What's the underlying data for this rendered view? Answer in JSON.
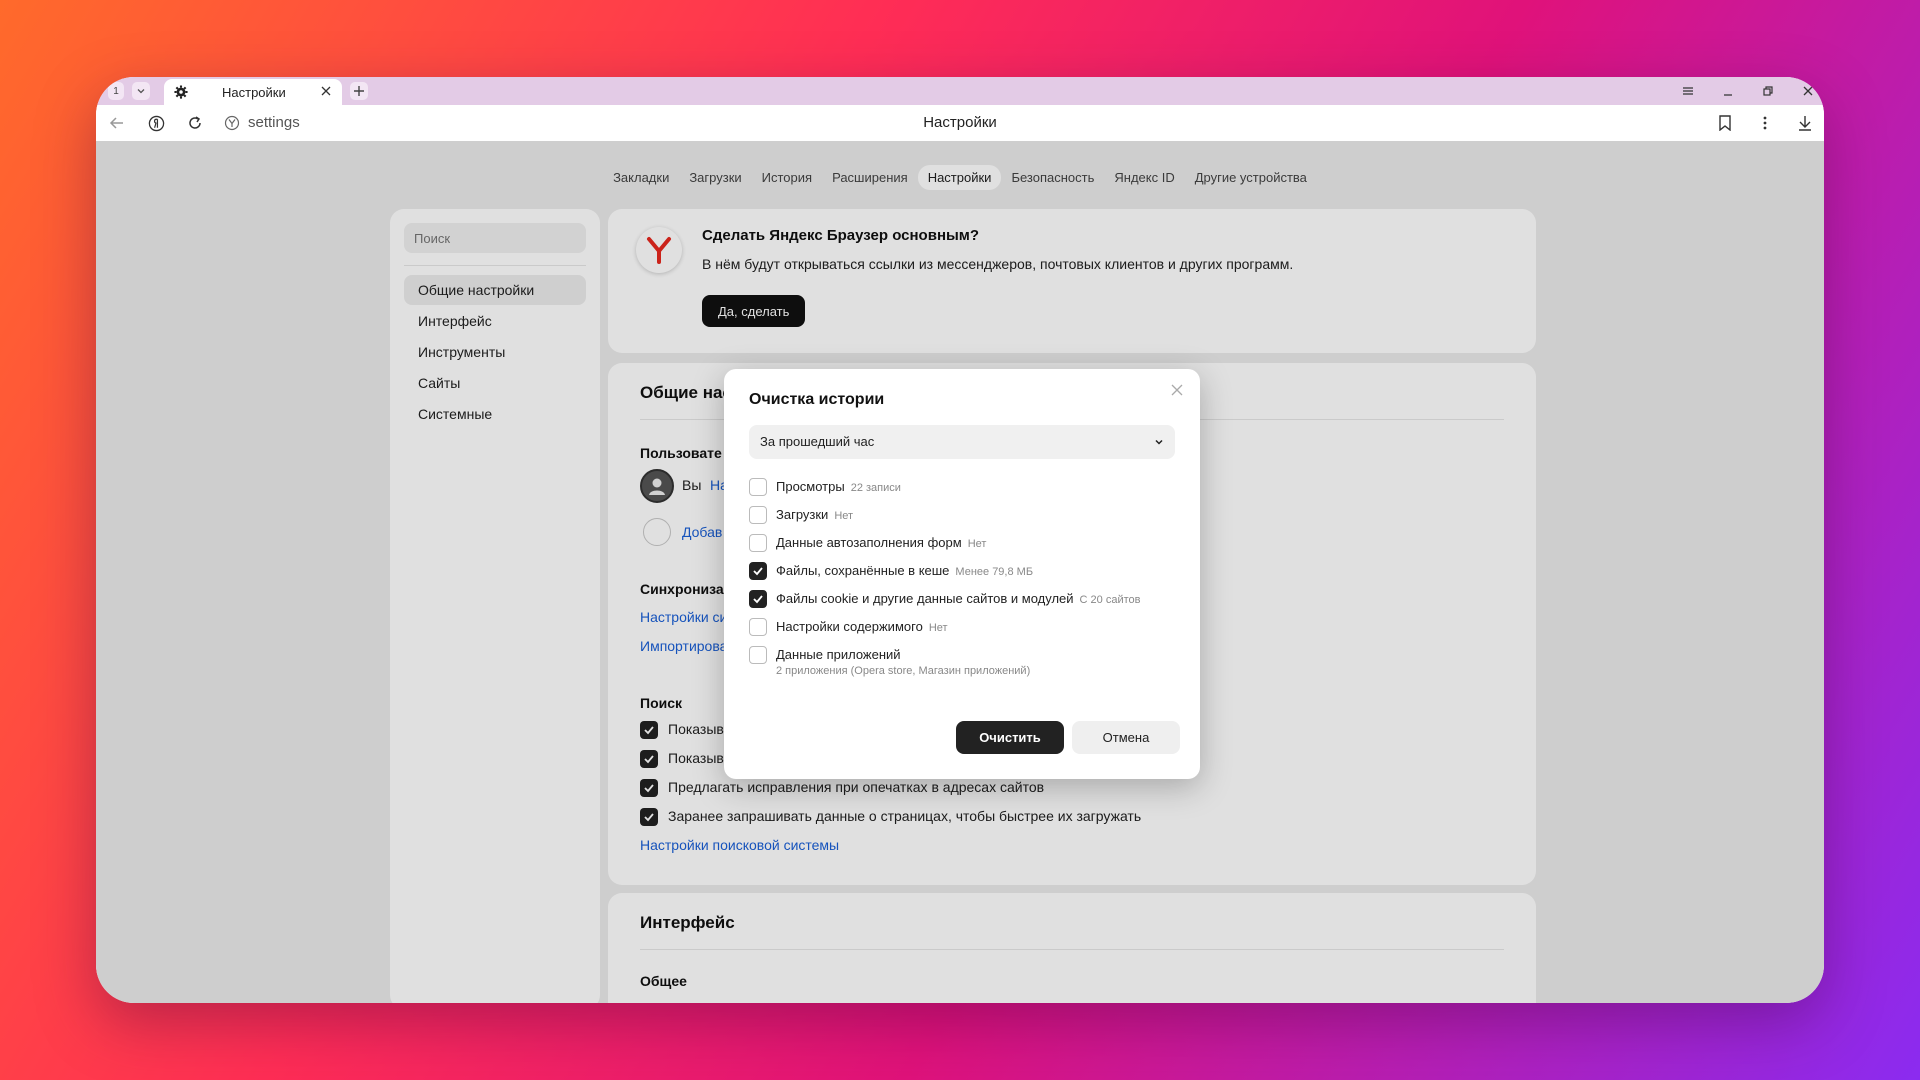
{
  "browser": {
    "tab_count": "1",
    "tab_title": "Настройки",
    "address": "settings",
    "page_title": "Настройки"
  },
  "nav_tabs": [
    {
      "label": "Закладки"
    },
    {
      "label": "Загрузки"
    },
    {
      "label": "История"
    },
    {
      "label": "Расширения"
    },
    {
      "label": "Настройки",
      "active": true
    },
    {
      "label": "Безопасность"
    },
    {
      "label": "Яндекс ID"
    },
    {
      "label": "Другие устройства"
    }
  ],
  "sidebar": {
    "search_placeholder": "Поиск",
    "items": [
      {
        "label": "Общие настройки"
      },
      {
        "label": "Интерфейс"
      },
      {
        "label": "Инструменты"
      },
      {
        "label": "Сайты"
      },
      {
        "label": "Системные"
      }
    ]
  },
  "promo": {
    "title": "Сделать Яндекс Браузер основным?",
    "text": "В нём будут открываться ссылки из мессенджеров, почтовых клиентов и других программ.",
    "button": "Да, сделать"
  },
  "general": {
    "title": "Общие нас",
    "users_title": "Пользовате",
    "you_label": "Вы",
    "you_link": "На",
    "add_link": "Добав",
    "sync_title": "Синхрониза",
    "sync_link1": "Настройки си",
    "sync_link2": "Импортирова",
    "search_title": "Поиск",
    "search_opts": [
      "Показыва",
      "Показыва",
      "Предлагать исправления при опечатках в адресах сайтов",
      "Заранее запрашивать данные о страницах, чтобы быстрее их загружать"
    ],
    "search_engine_link": "Настройки поисковой системы"
  },
  "interface": {
    "title": "Интерфейс",
    "sub": "Общее"
  },
  "dialog": {
    "title": "Очистка истории",
    "period": "За прошедший час",
    "options": [
      {
        "label": "Просмотры",
        "meta": "22 записи",
        "checked": false
      },
      {
        "label": "Загрузки",
        "meta": "Нет",
        "checked": false
      },
      {
        "label": "Данные автозаполнения форм",
        "meta": "Нет",
        "checked": false
      },
      {
        "label": "Файлы, сохранённые в кеше",
        "meta": "Менее 79,8 МБ",
        "checked": true
      },
      {
        "label": "Файлы cookie и другие данные сайтов и модулей",
        "meta": "С 20 сайтов",
        "checked": true
      },
      {
        "label": "Настройки содержимого",
        "meta": "Нет",
        "checked": false
      },
      {
        "label": "Данные приложений",
        "meta": "",
        "sub": "2 приложения (Opera store, Магазин приложений)",
        "checked": false
      }
    ],
    "clear_button": "Очистить",
    "cancel_button": "Отмена"
  }
}
